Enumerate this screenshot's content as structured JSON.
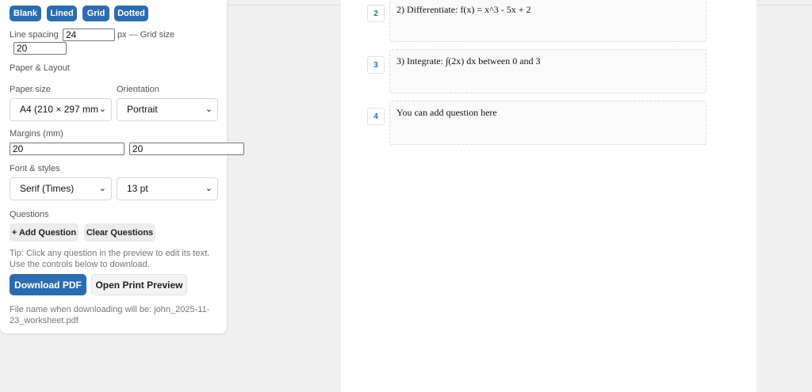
{
  "controls": {
    "patterns": [
      "Blank",
      "Lined",
      "Grid",
      "Dotted"
    ],
    "line_spacing_label": "Line spacing",
    "line_spacing_value": "24",
    "grid_size_label": "px — Grid size",
    "grid_size_value": "20",
    "paper_layout_heading": "Paper & Layout",
    "paper_size_label": "Paper size",
    "paper_size_value": "A4 (210 × 297 mm",
    "orientation_label": "Orientation",
    "orientation_value": "Portrait",
    "margins_label": "Margins (mm)",
    "margin_1": "20",
    "margin_2": "20",
    "font_heading": "Font & styles",
    "font_value": "Serif (Times)",
    "font_size_value": "13 pt",
    "questions_heading": "Questions",
    "add_question_label": "+ Add Question",
    "clear_questions_label": "Clear Questions",
    "tip_line1": "Tip: Click any question in the preview to edit its text.",
    "tip_line2": "Use the controls below to download.",
    "download_label": "Download PDF",
    "print_preview_label": "Open Print Preview",
    "filename_line1": "File name when downloading will be: john_2025-11-",
    "filename_line2": "23_worksheet.pdf",
    "accent_color": "#2b6cb0"
  },
  "preview": {
    "questions": [
      {
        "number": "2",
        "text": "2) Differentiate: f(x) = x^3 - 5x + 2"
      },
      {
        "number": "3",
        "text": "3) Integrate: ∫(2x) dx between 0 and 3"
      },
      {
        "number": "4",
        "text": "You can add question here"
      }
    ]
  }
}
